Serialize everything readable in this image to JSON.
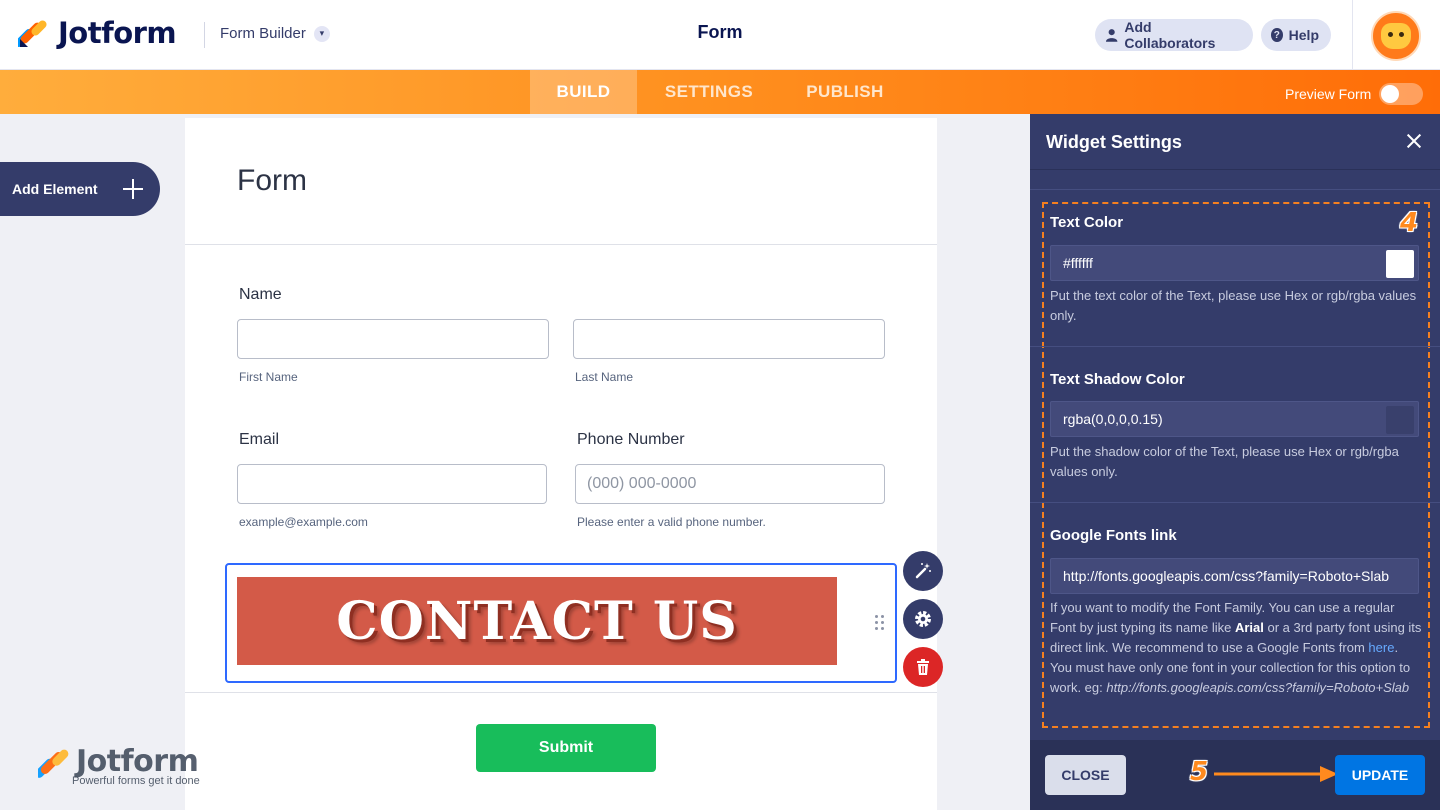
{
  "header": {
    "logo_text": "Jotform",
    "builder_select": "Form Builder",
    "form_title": "Form",
    "add_collaborators": "Add Collaborators",
    "help": "Help"
  },
  "nav": {
    "tabs": [
      {
        "label": "BUILD",
        "active": true
      },
      {
        "label": "SETTINGS",
        "active": false
      },
      {
        "label": "PUBLISH",
        "active": false
      }
    ],
    "preview_label": "Preview Form",
    "preview_on": false
  },
  "sidebar": {
    "add_element": "Add Element"
  },
  "form": {
    "heading": "Form",
    "name_label": "Name",
    "first_name_sub": "First Name",
    "last_name_sub": "Last Name",
    "email_label": "Email",
    "email_sub": "example@example.com",
    "phone_label": "Phone Number",
    "phone_placeholder": "(000) 000-0000",
    "phone_sub": "Please enter a valid phone number.",
    "image_text": "CONTACT US",
    "submit": "Submit"
  },
  "watermark": {
    "logo_text": "Jotform",
    "tagline": "Powerful forms get it done"
  },
  "panel": {
    "title": "Widget Settings",
    "text_color_label": "Text Color",
    "text_color_value": "#ffffff",
    "text_color_help": "Put the text color of the Text, please use Hex or rgb/rgba values only.",
    "shadow_label": "Text Shadow Color",
    "shadow_value": "rgba(0,0,0,0.15)",
    "shadow_help": "Put the shadow color of the Text, please use Hex or rgb/rgba values only.",
    "fonts_label": "Google Fonts link",
    "fonts_value": "http://fonts.googleapis.com/css?family=Roboto+Slab",
    "fonts_help_1": "If you want to modify the Font Family. You can use a regular Font by just typing its name like ",
    "fonts_help_arial": "Arial",
    "fonts_help_2": " or a 3rd party font using its direct link. We recommend to use a Google Fonts from ",
    "fonts_help_here": "here",
    "fonts_help_3": ". You must have only one font in your collection for this option to work. eg: ",
    "fonts_help_example": "http://fonts.googleapis.com/css?family=Roboto+Slab",
    "close_btn": "CLOSE",
    "update_btn": "UPDATE"
  },
  "annotations": {
    "step4": "4",
    "step5": "5"
  },
  "colors": {
    "accent_orange": "#ff8a1e",
    "panel_bg": "#343c6a",
    "update_blue": "#0075e3",
    "submit_green": "#18bd5b",
    "image_bg": "#d35a48"
  }
}
